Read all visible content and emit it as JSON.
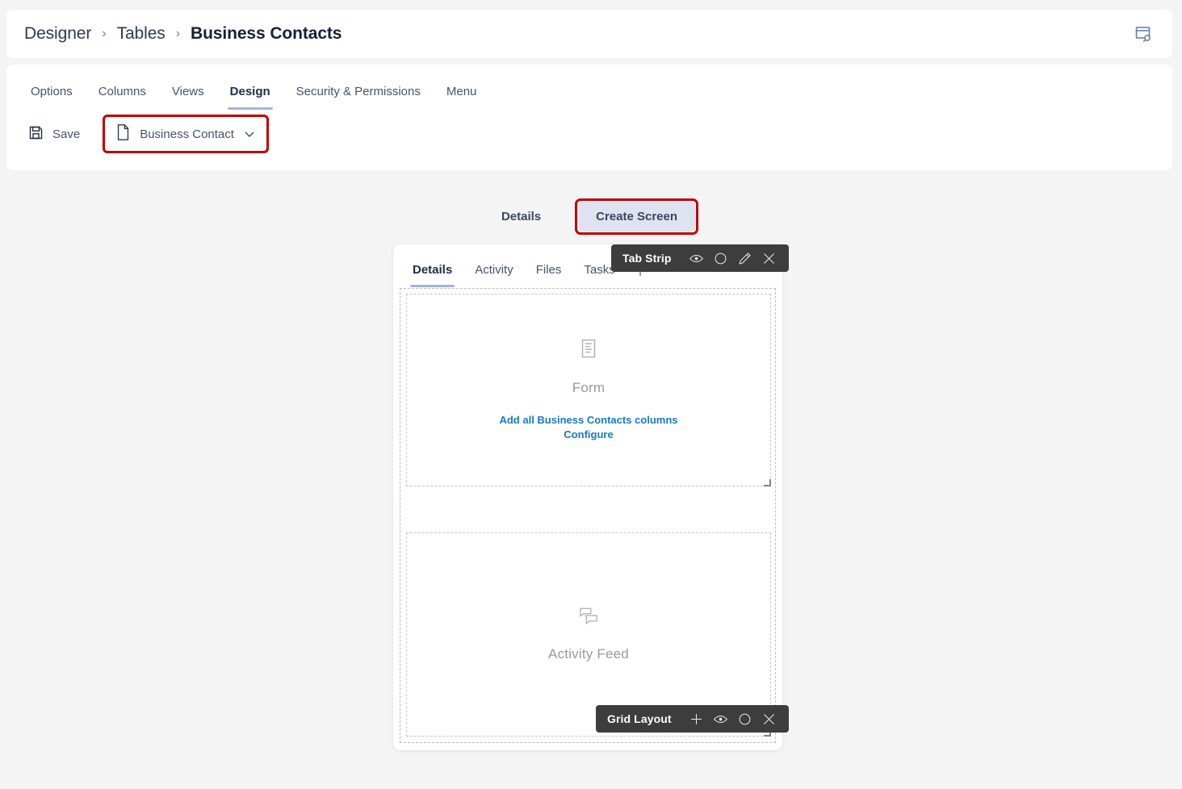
{
  "breadcrumb": {
    "items": [
      {
        "label": "Designer"
      },
      {
        "label": "Tables"
      },
      {
        "label": "Business Contacts"
      }
    ],
    "separator": "›",
    "action_icon": "window-search-icon"
  },
  "tabs": [
    {
      "label": "Options",
      "active": false
    },
    {
      "label": "Columns",
      "active": false
    },
    {
      "label": "Views",
      "active": false
    },
    {
      "label": "Design",
      "active": true
    },
    {
      "label": "Security & Permissions",
      "active": false
    },
    {
      "label": "Menu",
      "active": false
    }
  ],
  "toolbar": {
    "save_label": "Save",
    "save_icon": "save-floppy-icon",
    "dropdown": {
      "label": "Business Contact",
      "icon": "document-icon",
      "chevron": "chevron-down-icon",
      "highlight_color": "#c00000"
    }
  },
  "segmented": {
    "items": [
      {
        "label": "Details",
        "selected": false,
        "highlighted": false
      },
      {
        "label": "Create Screen",
        "selected": true,
        "highlighted": true
      }
    ],
    "selected_bg": "#dfe3f0",
    "highlight_color": "#c00000"
  },
  "canvas": {
    "inner_tabs": [
      {
        "label": "Details",
        "active": true
      },
      {
        "label": "Activity",
        "active": false
      },
      {
        "label": "Files",
        "active": false
      },
      {
        "label": "Tasks",
        "active": false
      }
    ],
    "add_tab_icon": "plus-icon",
    "active_underline_color": "#a3b5dd",
    "regions": [
      {
        "name": "form",
        "icon": "form-document-icon",
        "title": "Form",
        "links": [
          "Add all Business Contacts columns",
          "Configure"
        ],
        "link_color": "#1878c8"
      },
      {
        "name": "activity-feed",
        "icon": "chat-bubbles-icon",
        "title": "Activity Feed",
        "links": []
      }
    ]
  },
  "floating_toolbars": [
    {
      "id": "tab-strip",
      "label": "Tab Strip",
      "buttons": [
        {
          "name": "visibility-eye-icon"
        },
        {
          "name": "circle-icon"
        },
        {
          "name": "pencil-edit-icon"
        },
        {
          "name": "close-x-icon"
        }
      ],
      "background": "#3d3d3d"
    },
    {
      "id": "grid-layout",
      "label": "Grid Layout",
      "buttons": [
        {
          "name": "plus-icon"
        },
        {
          "name": "visibility-eye-icon"
        },
        {
          "name": "circle-icon"
        },
        {
          "name": "close-x-icon"
        }
      ],
      "background": "#3d3d3d"
    }
  ]
}
